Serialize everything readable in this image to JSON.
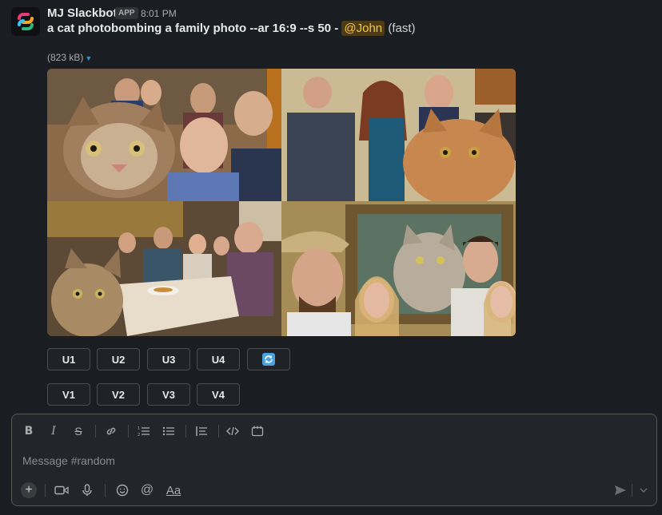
{
  "message": {
    "sender": "MJ Slackbot",
    "badge": "APP",
    "time": "8:01 PM",
    "prompt": "a cat photobombing a family photo --ar 16:9 --s 50 -",
    "mention": "@John",
    "speed": "(fast)",
    "file_size": "(823 kB)"
  },
  "buttons": {
    "upscale": [
      "U1",
      "U2",
      "U3",
      "U4"
    ],
    "variation": [
      "V1",
      "V2",
      "V3",
      "V4"
    ],
    "reroll_icon": "refresh-icon"
  },
  "composer": {
    "placeholder": "Message #random",
    "format_icons": [
      "bold-icon",
      "italic-icon",
      "strikethrough-icon",
      "link-icon",
      "ordered-list-icon",
      "bullet-list-icon",
      "blockquote-icon",
      "code-icon",
      "code-block-icon"
    ],
    "bottom_icons": [
      "plus-icon",
      "video-icon",
      "microphone-icon",
      "emoji-icon",
      "mention-icon",
      "formatting-icon",
      "send-icon",
      "send-options-icon"
    ],
    "format_label": "Aa"
  },
  "colors": {
    "background": "#1a1d21",
    "mention_bg": "#4d3a17",
    "mention_text": "#f2c744",
    "link_blue": "#1d9bd1"
  }
}
